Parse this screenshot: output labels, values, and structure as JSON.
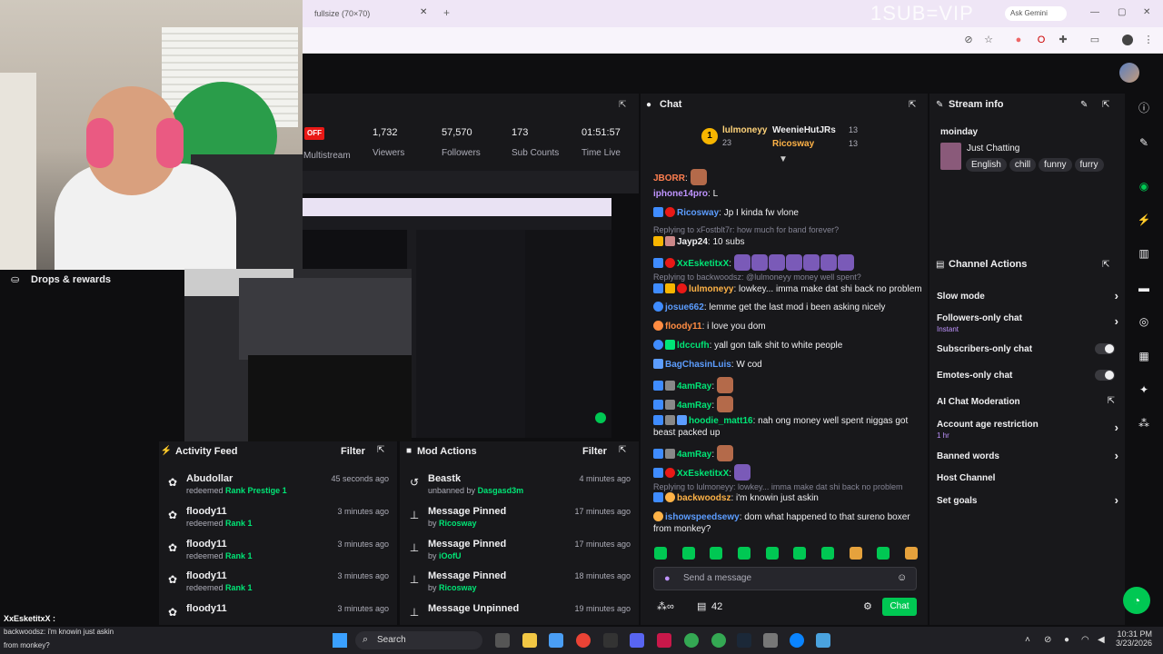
{
  "browser": {
    "tab_title": "fullsize (70×70)",
    "overlay_text": "1SUB=VIP",
    "ask_gemini": "Ask Gemini"
  },
  "stats": {
    "off_badge": "OFF",
    "multistream_label": "Multistream",
    "items": [
      {
        "value": "1,732",
        "label": "Viewers"
      },
      {
        "value": "57,570",
        "label": "Followers"
      },
      {
        "value": "173",
        "label": "Sub Counts"
      },
      {
        "value": "01:51:57",
        "label": "Time Live"
      }
    ]
  },
  "drops": {
    "label": "Drops & rewards"
  },
  "activity": {
    "title": "Activity Feed",
    "filter": "Filter",
    "items": [
      {
        "name": "Abudollar",
        "action": "redeemed",
        "reward": "Rank Prestige 1",
        "time": "45 seconds ago"
      },
      {
        "name": "floody11",
        "action": "redeemed",
        "reward": "Rank 1",
        "time": "3 minutes ago"
      },
      {
        "name": "floody11",
        "action": "redeemed",
        "reward": "Rank 1",
        "time": "3 minutes ago"
      },
      {
        "name": "floody11",
        "action": "redeemed",
        "reward": "Rank 1",
        "time": "3 minutes ago"
      },
      {
        "name": "floody11",
        "action": "",
        "reward": "",
        "time": "3 minutes ago"
      }
    ]
  },
  "modactions": {
    "title": "Mod Actions",
    "filter": "Filter",
    "items": [
      {
        "title": "Beastk",
        "by_prefix": "unbanned by",
        "by": "Dasgasd3m",
        "time": "4 minutes ago",
        "icon": "unban-icon"
      },
      {
        "title": "Message Pinned",
        "by_prefix": "by",
        "by": "Ricosway",
        "time": "17 minutes ago",
        "icon": "pin-icon"
      },
      {
        "title": "Message Pinned",
        "by_prefix": "by",
        "by": "iOofU",
        "time": "17 minutes ago",
        "icon": "pin-icon"
      },
      {
        "title": "Message Pinned",
        "by_prefix": "by",
        "by": "Ricosway",
        "time": "18 minutes ago",
        "icon": "pin-icon"
      },
      {
        "title": "Message Unpinned",
        "by_prefix": "",
        "by": "",
        "time": "19 minutes ago",
        "icon": "unpin-icon"
      }
    ]
  },
  "chat": {
    "title": "Chat",
    "leaderboard": {
      "first": {
        "rank": "1",
        "name": "lulmoneyy",
        "count": "23"
      },
      "second": {
        "name": "WeenieHutJRs",
        "count": "13"
      },
      "third": {
        "name": "Ricosway",
        "count": "13"
      }
    },
    "messages": [
      {
        "user": "JBORR",
        "color": "#ff7f50",
        "text": ""
      },
      {
        "user": "iphone14pro",
        "color": "#bf94ff",
        "text": "L"
      },
      {
        "user": "Ricosway",
        "color": "#5c9dff",
        "text": "Jp I kinda fw vlone"
      },
      {
        "reply": "Replying to xFostblt7r: how much for band forever?"
      },
      {
        "user": "Jayp24",
        "color": "#efeff1",
        "text": "10 subs"
      },
      {
        "user": "XxEsketitxX",
        "color": "#00e676",
        "text": ""
      },
      {
        "reply": "Replying to backwoodsz: @lulmoneyy money well spent?"
      },
      {
        "user": "lulmoneyy",
        "color": "#ffb347",
        "text": "lowkey... imma make dat shi back no problem"
      },
      {
        "user": "josue662",
        "color": "#5c9dff",
        "text": "lemme get the last mod i been asking nicely"
      },
      {
        "user": "floody11",
        "color": "#ff8c42",
        "text": "i love you dom"
      },
      {
        "user": "ldccufh",
        "color": "#00e676",
        "text": "yall gon talk shit to white people"
      },
      {
        "user": "BagChasinLuis",
        "color": "#5c9dff",
        "text": "W cod"
      },
      {
        "user": "4amRay",
        "color": "#00e676",
        "text": ""
      },
      {
        "user": "4amRay",
        "color": "#00e676",
        "text": ""
      },
      {
        "user": "hoodie_matt16",
        "color": "#00e676",
        "text": "nah ong money well spent niggas got beast packed up"
      },
      {
        "user": "4amRay",
        "color": "#00e676",
        "text": ""
      },
      {
        "user": "XxEsketitxX",
        "color": "#00e676",
        "text": ""
      },
      {
        "reply": "Replying to lulmoneyy: lowkey... imma make dat shi back no problem"
      },
      {
        "user": "backwoodsz",
        "color": "#ffb347",
        "text": "i'm knowin just askin"
      },
      {
        "user": "ishowspeedsewy",
        "color": "#5c9dff",
        "text": "dom what happened to that sureno boxer from monkey?"
      }
    ],
    "input_placeholder": "Send a message",
    "points": "42",
    "chat_button": "Chat"
  },
  "streaminfo": {
    "title": "Stream info",
    "stream_title": "moinday",
    "category": "Just Chatting",
    "tags": [
      "English",
      "chill",
      "funny",
      "furry"
    ]
  },
  "channelactions": {
    "title": "Channel Actions",
    "items": [
      {
        "label": "Slow mode",
        "sub": "",
        "control": "chevron"
      },
      {
        "label": "Followers-only chat",
        "sub": "Instant",
        "control": "chevron"
      },
      {
        "label": "Subscribers-only chat",
        "sub": "",
        "control": "toggle"
      },
      {
        "label": "Emotes-only chat",
        "sub": "",
        "control": "toggle"
      },
      {
        "label": "AI Chat Moderation",
        "sub": "",
        "control": "external"
      },
      {
        "label": "Account age restriction",
        "sub": "1 hr",
        "control": "chevron"
      },
      {
        "label": "Banned words",
        "sub": "",
        "control": "chevron"
      },
      {
        "label": "Host Channel",
        "sub": "",
        "control": "none"
      },
      {
        "label": "Set goals",
        "sub": "",
        "control": "chevron"
      }
    ]
  },
  "overlay": {
    "line1_user": "XxEsketitxX",
    "line1_sep": ":",
    "line2": "backwoodsz: i'm knowin just askin",
    "line3": "from monkey?"
  },
  "taskbar": {
    "search": "Search",
    "time": "10:31 PM",
    "date": "3/23/2026"
  },
  "colors": {
    "accent_green": "#00c853",
    "twitch_purple": "#bf94ff",
    "offline_red": "#e91916"
  }
}
